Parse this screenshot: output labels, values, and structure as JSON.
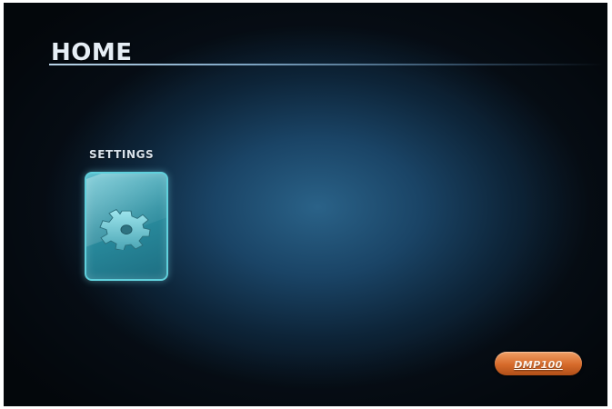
{
  "header": {
    "title": "HOME"
  },
  "menu": {
    "items": [
      {
        "label": "SETTINGS",
        "icon": "gear-icon",
        "selected": true
      }
    ]
  },
  "brand": {
    "badge_text": "DMP100"
  },
  "colors": {
    "background": "#1a4466",
    "tile_accent": "#4fb9c9",
    "badge": "#d66a2a"
  }
}
